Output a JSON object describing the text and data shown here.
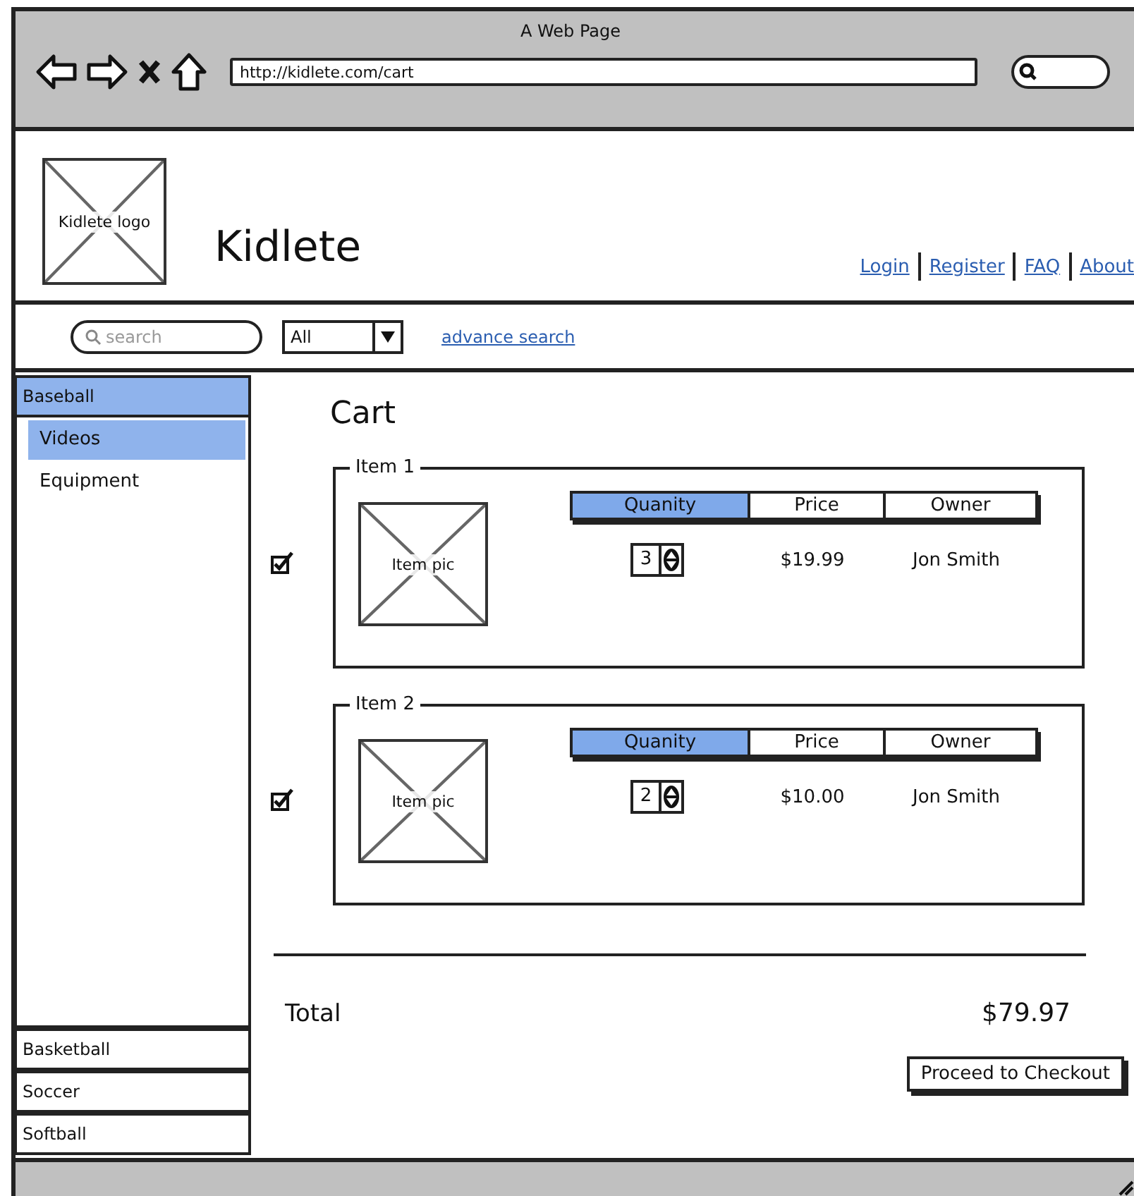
{
  "window": {
    "title": "A Web Page",
    "url": "http://kidlete.com/cart"
  },
  "header": {
    "logo_label": "Kidlete logo",
    "site_name": "Kidlete",
    "links": [
      "Login",
      "Register",
      "FAQ",
      "About"
    ]
  },
  "search": {
    "placeholder": "search",
    "category": "All",
    "advanced_link": "advance search"
  },
  "sidebar": {
    "items": [
      {
        "label": "Baseball",
        "selected": true,
        "expanded": true,
        "children": [
          {
            "label": "Videos",
            "selected": true
          },
          {
            "label": "Equipment",
            "selected": false
          }
        ]
      },
      {
        "label": "Basketball",
        "selected": false,
        "expanded": false
      },
      {
        "label": "Soccer",
        "selected": false,
        "expanded": false
      },
      {
        "label": "Softball",
        "selected": false,
        "expanded": false
      }
    ]
  },
  "cart": {
    "title": "Cart",
    "items": [
      {
        "legend": "Item 1",
        "checked": true,
        "picture_label": "Item pic",
        "columns": [
          {
            "label": "Quanity",
            "selected": true
          },
          {
            "label": "Price",
            "selected": false
          },
          {
            "label": "Owner",
            "selected": false
          }
        ],
        "quantity": "3",
        "price": "$19.99",
        "owner": "Jon Smith"
      },
      {
        "legend": "Item 2",
        "checked": true,
        "picture_label": "Item pic",
        "columns": [
          {
            "label": "Quanity",
            "selected": true
          },
          {
            "label": "Price",
            "selected": false
          },
          {
            "label": "Owner",
            "selected": false
          }
        ],
        "quantity": "2",
        "price": "$10.00",
        "owner": "Jon Smith"
      }
    ],
    "total_label": "Total",
    "total": "$79.97",
    "checkout_button": "Proceed to Checkout"
  }
}
